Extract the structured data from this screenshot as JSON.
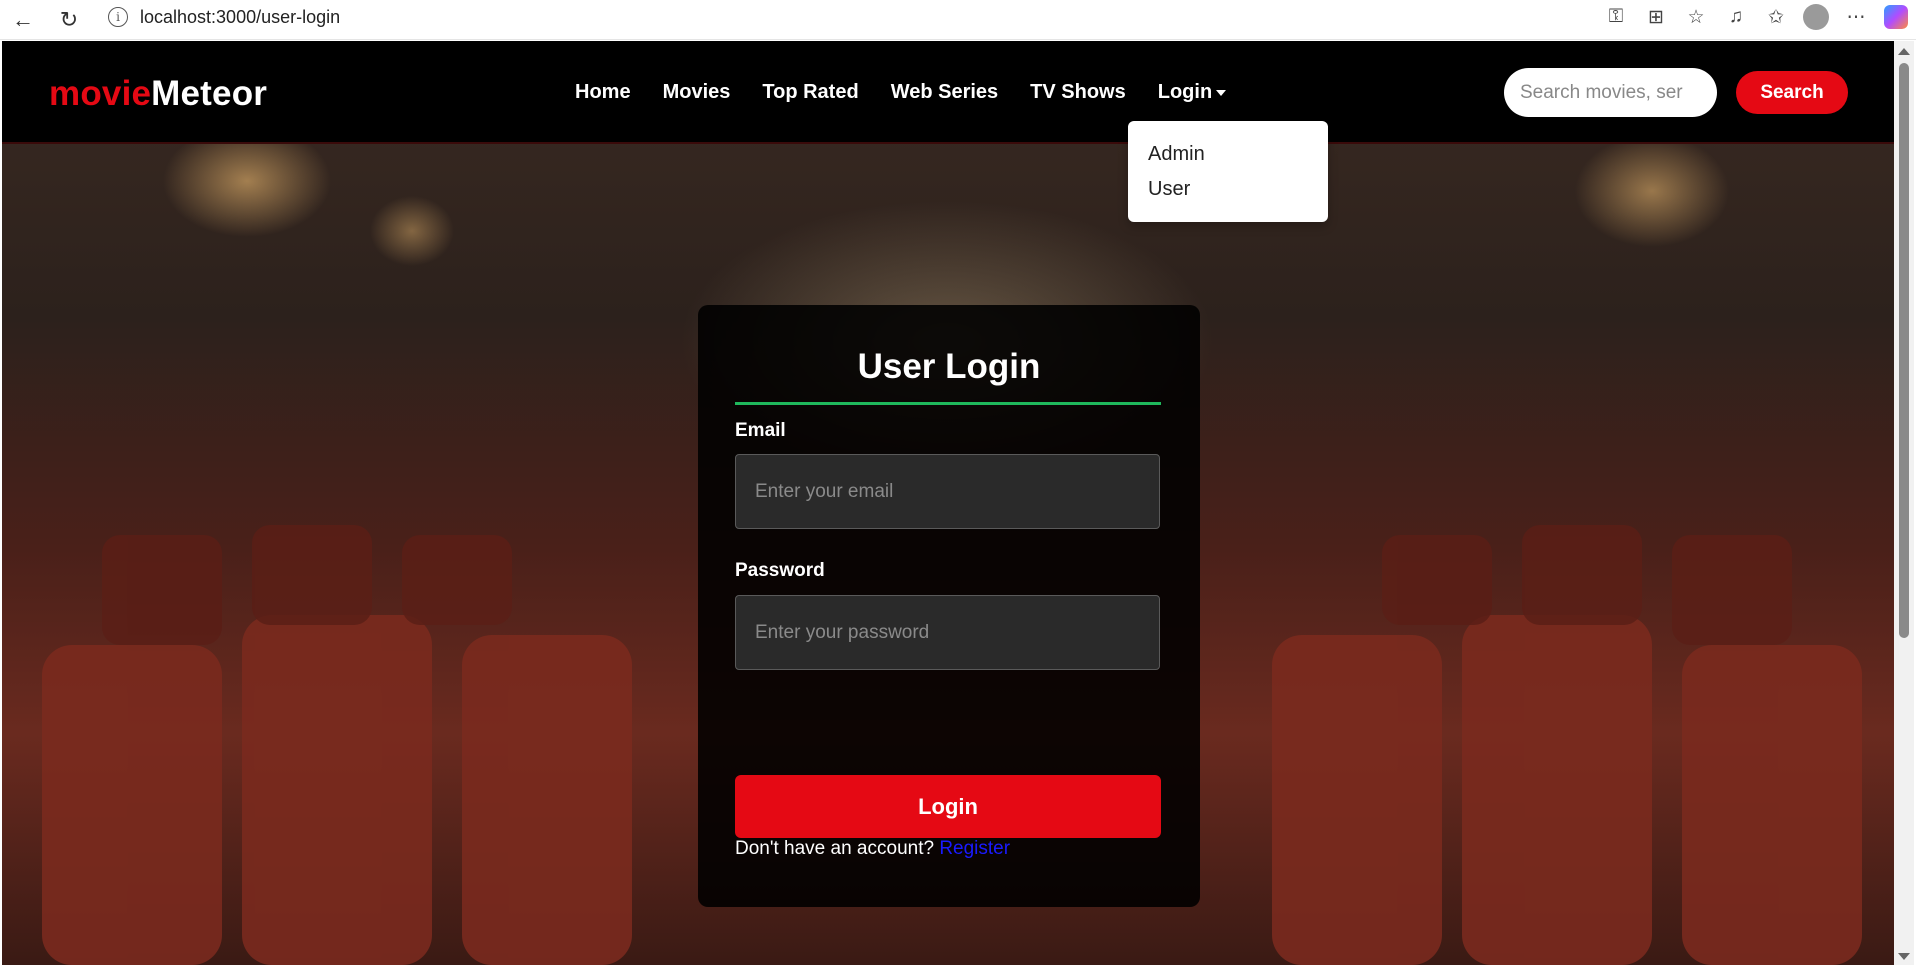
{
  "browser": {
    "url": "localhost:3000/user-login",
    "info_glyph": "i"
  },
  "brand": {
    "part1": "movie",
    "part2": "Meteor"
  },
  "nav": {
    "items": [
      "Home",
      "Movies",
      "Top Rated",
      "Web Series",
      "TV Shows"
    ],
    "login_label": "Login"
  },
  "search": {
    "placeholder": "Search movies, ser",
    "button": "Search"
  },
  "dropdown": {
    "items": [
      "Admin",
      "User"
    ]
  },
  "login_card": {
    "title": "User Login",
    "email_label": "Email",
    "email_placeholder": "Enter your email",
    "password_label": "Password",
    "password_placeholder": "Enter your password",
    "submit": "Login",
    "footer_text": "Don't have an account? ",
    "register_link": "Register"
  },
  "colors": {
    "accent": "#e50914",
    "rule": "#1fb85c",
    "link": "#1a1aff"
  }
}
